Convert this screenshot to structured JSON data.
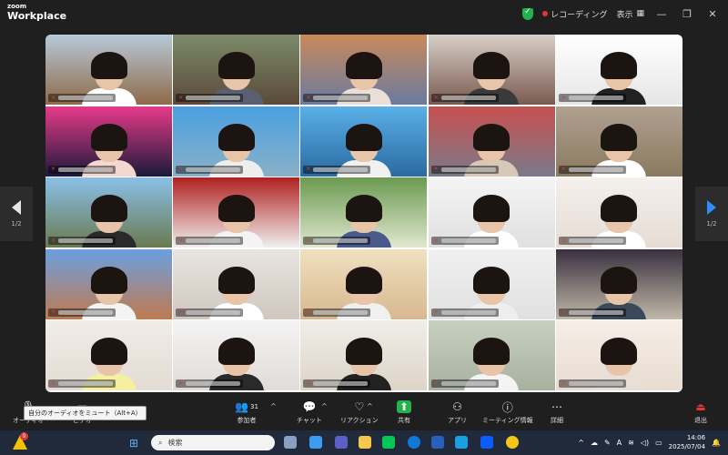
{
  "app": {
    "logo_top": "zoom",
    "logo_bottom": "Workplace"
  },
  "titlebar": {
    "recording_label": "レコーディング",
    "view_label": "表示",
    "minimize": "—",
    "restore": "❐",
    "close": "✕"
  },
  "pagination": {
    "left_page": "1/2",
    "right_page": "1/2"
  },
  "toolbar": {
    "audio_label": "オーディオ",
    "video_label": "ビデオ",
    "participants_label": "参加者",
    "participants_count": "31",
    "chat_label": "チャット",
    "reactions_label": "リアクション",
    "share_label": "共有",
    "apps_label": "アプリ",
    "meeting_info_label": "ミーティング情報",
    "more_label": "詳細",
    "leave_label": "退出",
    "caret": "^"
  },
  "tooltip": "自分のオーディオをミュート（Alt+A）",
  "taskbar": {
    "search_placeholder": "検索",
    "notification_badge": "9",
    "ime_indicator": "A",
    "time": "14:06",
    "date": "2025/07/04"
  },
  "colors": {
    "active_speaker": "#27d07a",
    "accent": "#2d8cff",
    "share": "#22b14c",
    "muted": "#e23636"
  },
  "participants_tiles": 25
}
